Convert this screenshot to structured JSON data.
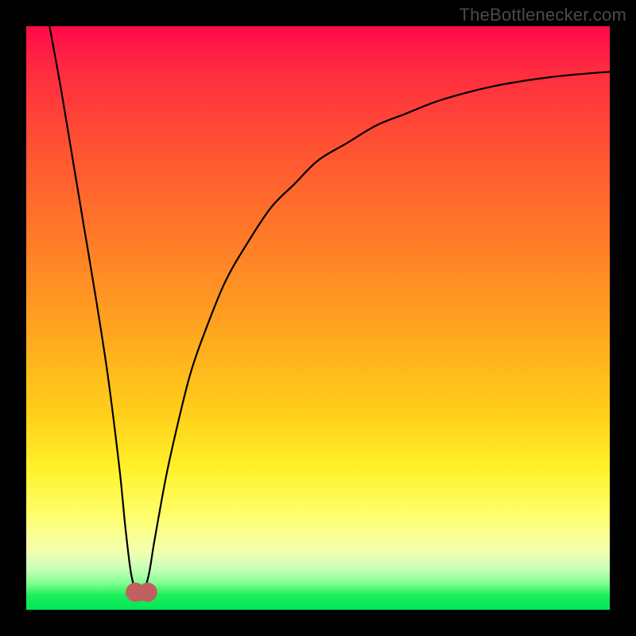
{
  "attribution": "TheBottlenecker.com",
  "colors": {
    "frame": "#000000",
    "gradient_top": "#ff0a4a",
    "gradient_bottom": "#00e758",
    "curve_stroke": "#000000",
    "marker_fill": "#c16060"
  },
  "chart_data": {
    "type": "line",
    "title": "",
    "xlabel": "",
    "ylabel": "",
    "xlim": [
      0,
      100
    ],
    "ylim": [
      0,
      100
    ],
    "grid": false,
    "legend": false,
    "annotations": [],
    "series": [
      {
        "name": "bottleneck-curve",
        "x": [
          4,
          6,
          8,
          10,
          12,
          14,
          16,
          17,
          18,
          19,
          20,
          21,
          22,
          24,
          26,
          28,
          30,
          34,
          38,
          42,
          46,
          50,
          55,
          60,
          65,
          70,
          75,
          80,
          85,
          90,
          95,
          100
        ],
        "y": [
          100,
          89,
          77,
          65,
          53,
          40,
          24,
          14,
          6,
          3,
          3,
          6,
          12,
          23,
          32,
          40,
          46,
          56,
          63,
          69,
          73,
          77,
          80,
          83,
          85,
          87,
          88.5,
          89.7,
          90.6,
          91.3,
          91.8,
          92.2
        ]
      }
    ],
    "markers": [
      {
        "x": 18.7,
        "y": 3.0,
        "r": 1.0
      },
      {
        "x": 20.8,
        "y": 3.0,
        "r": 1.0
      }
    ],
    "trough_bridge": {
      "x0": 18.7,
      "x1": 20.8,
      "y": 2.5
    }
  }
}
